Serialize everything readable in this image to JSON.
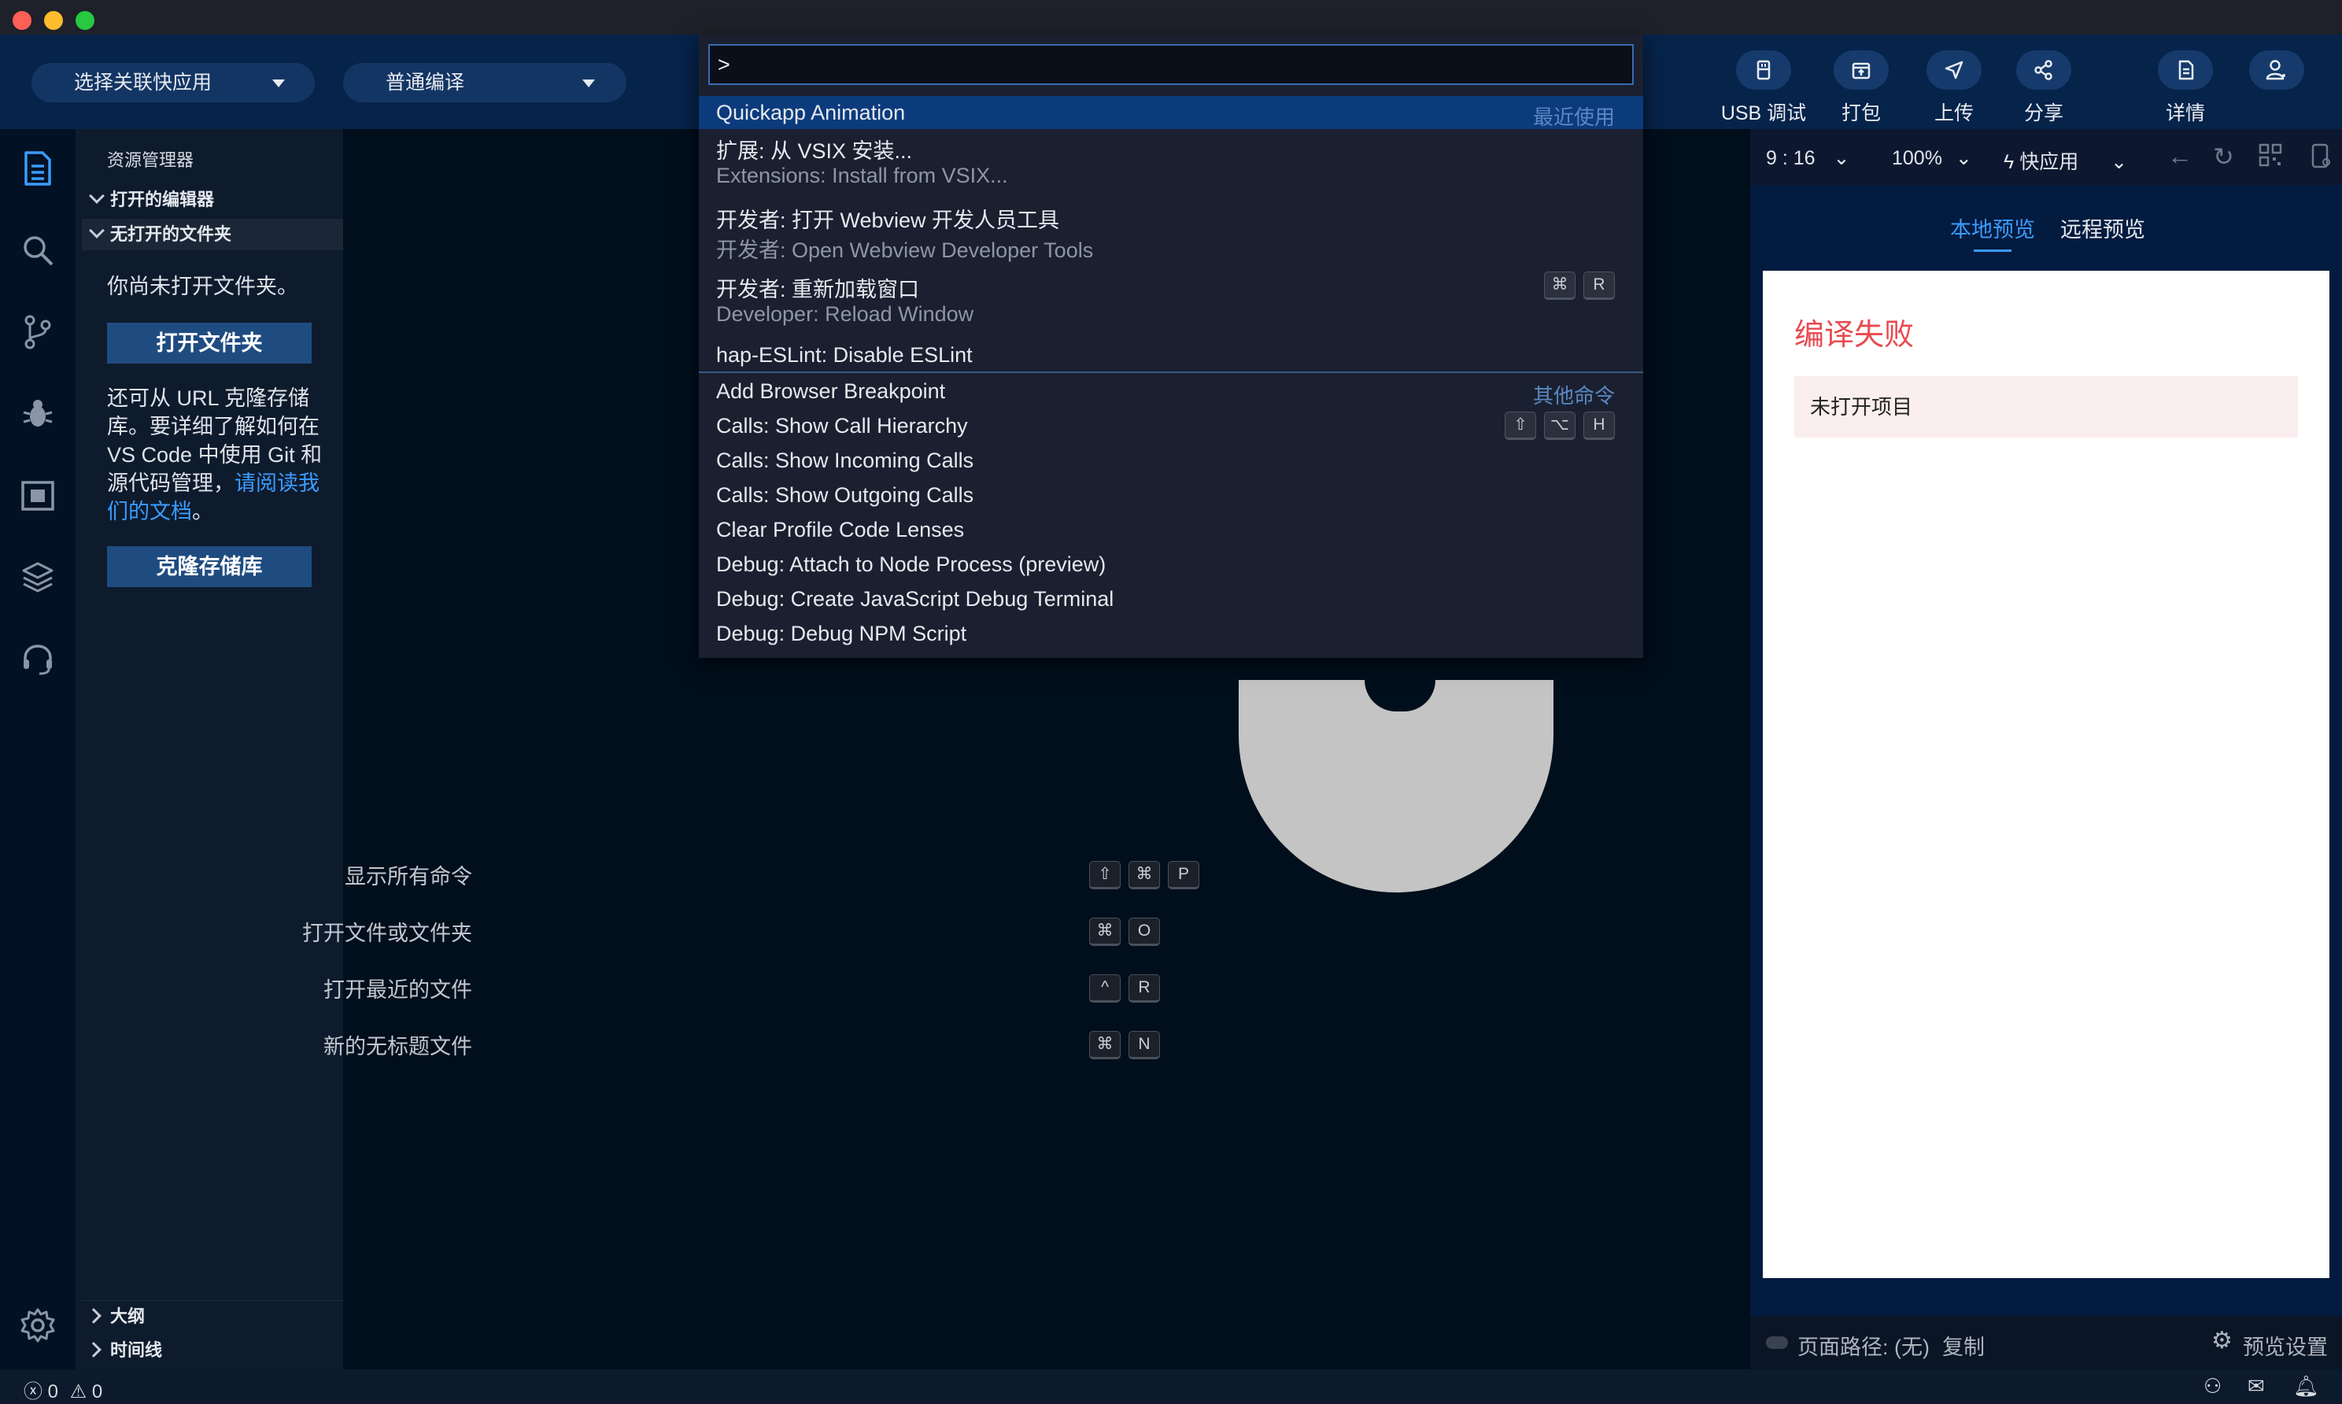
{
  "toolbar": {
    "app_select": "选择关联快应用",
    "compile_select": "普通编译",
    "buttons": [
      {
        "label": "USB 调试",
        "icon": "usb-icon"
      },
      {
        "label": "打包",
        "icon": "package-icon"
      },
      {
        "label": "上传",
        "icon": "upload-icon"
      },
      {
        "label": "分享",
        "icon": "share-icon"
      },
      {
        "label": "详情",
        "icon": "details-icon"
      },
      {
        "label": "",
        "icon": "account-icon"
      }
    ]
  },
  "activity_bar": [
    "explorer-icon",
    "search-icon",
    "source-control-icon",
    "debug-icon",
    "remote-icon",
    "layers-icon",
    "headset-icon",
    "gear-icon"
  ],
  "sidebar": {
    "title": "资源管理器",
    "open_editors": "打开的编辑器",
    "no_folder": "无打开的文件夹",
    "no_folder_msg": "你尚未打开文件夹。",
    "open_folder_btn": "打开文件夹",
    "clone_msg": "还可从 URL 克隆存储库。要详细了解如何在 VS Code 中使用 Git 和源代码管理，",
    "clone_link": "请阅读我们的文档",
    "clone_msg_end": "。",
    "clone_btn": "克隆存储库",
    "outline": "大纲",
    "timeline": "时间线"
  },
  "editor": {
    "hints": [
      {
        "label": "显示所有命令",
        "keys": [
          "⇧",
          "⌘",
          "P"
        ]
      },
      {
        "label": "打开文件或文件夹",
        "keys": [
          "⌘",
          "O"
        ]
      },
      {
        "label": "打开最近的文件",
        "keys": [
          "^",
          "R"
        ]
      },
      {
        "label": "新的无标题文件",
        "keys": [
          "⌘",
          "N"
        ]
      }
    ]
  },
  "palette": {
    "input_value": ">",
    "recent_tag": "最近使用",
    "other_tag": "其他命令",
    "items": [
      {
        "title": "Quickapp Animation",
        "sub": ""
      },
      {
        "title": "扩展: 从 VSIX 安装...",
        "sub": "Extensions: Install from VSIX..."
      },
      {
        "title": "开发者: 打开 Webview 开发人员工具",
        "sub": "开发者: Open Webview Developer Tools"
      },
      {
        "title": "开发者: 重新加载窗口",
        "sub": "Developer: Reload Window",
        "keys": [
          "⌘",
          "R"
        ]
      },
      {
        "title": "hap-ESLint: Disable ESLint",
        "sub": ""
      },
      {
        "title": "Add Browser Breakpoint",
        "sub": ""
      },
      {
        "title": "Calls: Show Call Hierarchy",
        "sub": "",
        "keys": [
          "⇧",
          "⌥",
          "H"
        ]
      },
      {
        "title": "Calls: Show Incoming Calls",
        "sub": ""
      },
      {
        "title": "Calls: Show Outgoing Calls",
        "sub": ""
      },
      {
        "title": "Clear Profile Code Lenses",
        "sub": ""
      },
      {
        "title": "Debug: Attach to Node Process (preview)",
        "sub": ""
      },
      {
        "title": "Debug: Create JavaScript Debug Terminal",
        "sub": ""
      },
      {
        "title": "Debug: Debug NPM Script",
        "sub": ""
      }
    ]
  },
  "preview": {
    "ratio": "9 : 16",
    "zoom": "100%",
    "app_type": "快应用",
    "tab_local": "本地预览",
    "tab_remote": "远程预览",
    "error_title": "编译失败",
    "error_msg": "未打开项目",
    "page_path": "页面路径: (无)",
    "copy": "复制",
    "settings": "预览设置"
  },
  "status": {
    "errors": "0",
    "warnings": "0"
  },
  "colors": {
    "accent": "#3b9cff",
    "selection": "#0c3b7d",
    "error": "#e84a50"
  }
}
